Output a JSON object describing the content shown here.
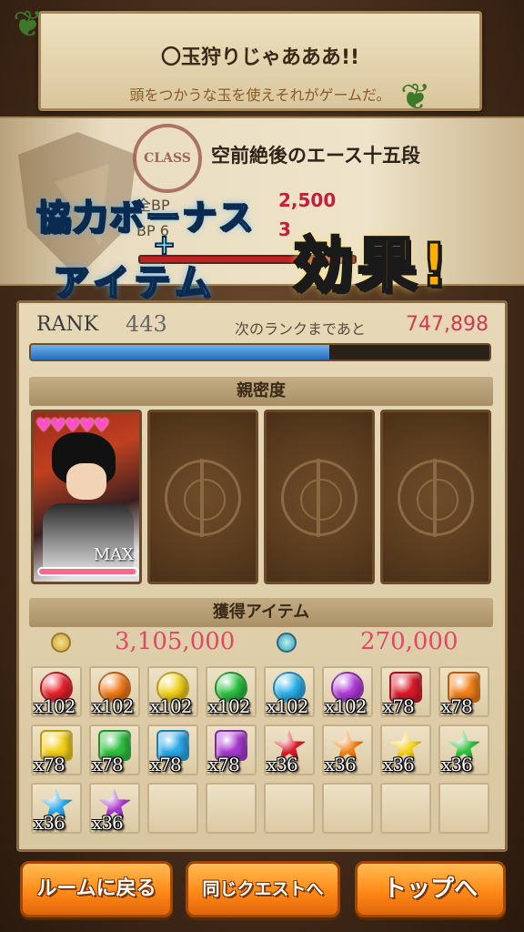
{
  "banner": {
    "title": "〇玉狩りじゃあああ!!",
    "subtitle": "頭をつかうな玉を使えそれがゲームだ。"
  },
  "class": {
    "stamp": "CLASS",
    "name": "空前絶後のエース十五段",
    "row1_label": "全BP",
    "row1_value": "2,500",
    "row2_label": "BP 6",
    "row2_value": "3"
  },
  "overlay": {
    "line1": "協力ボーナス",
    "plus": "+",
    "line2": "アイテム",
    "effect": "効果!"
  },
  "rank": {
    "label": "RANK",
    "value": "443",
    "next_label": "次のランクまであと",
    "next_value": "747,898",
    "progress": 0.65
  },
  "affinity": {
    "header": "親密度",
    "card_max": "MAX",
    "hearts": "♥♥♥♥♥",
    "affinity_level": 0.98
  },
  "items_header": "獲得アイテム",
  "rewards": {
    "coins": "3,105,000",
    "souls": "270,000"
  },
  "items": [
    {
      "color": "#e8202a",
      "shape": "round",
      "qty": "x102"
    },
    {
      "color": "#f07a18",
      "shape": "round",
      "qty": "x102"
    },
    {
      "color": "#f2d018",
      "shape": "round",
      "qty": "x102"
    },
    {
      "color": "#2ac040",
      "shape": "round",
      "qty": "x102"
    },
    {
      "color": "#28b0e8",
      "shape": "round",
      "qty": "x102"
    },
    {
      "color": "#b03ad8",
      "shape": "round",
      "qty": "x102"
    },
    {
      "color": "#d81a2a",
      "shape": "hex",
      "qty": "x78"
    },
    {
      "color": "#f08018",
      "shape": "hex",
      "qty": "x78"
    },
    {
      "color": "#f2d018",
      "shape": "hex",
      "qty": "x78"
    },
    {
      "color": "#30c040",
      "shape": "hex",
      "qty": "x78"
    },
    {
      "color": "#2aa8e8",
      "shape": "hex",
      "qty": "x78"
    },
    {
      "color": "#a83ad0",
      "shape": "hex",
      "qty": "x78"
    },
    {
      "color": "#d81a2a",
      "shape": "star",
      "qty": "x36"
    },
    {
      "color": "#f08018",
      "shape": "star",
      "qty": "x36"
    },
    {
      "color": "#f2d018",
      "shape": "star",
      "qty": "x36"
    },
    {
      "color": "#30c040",
      "shape": "star",
      "qty": "x36"
    },
    {
      "color": "#2aa8e8",
      "shape": "star",
      "qty": "x36"
    },
    {
      "color": "#a83ad0",
      "shape": "star",
      "qty": "x36"
    }
  ],
  "buttons": {
    "room": "ルームに戻る",
    "same_quest": "同じクエストへ",
    "top": "トップへ"
  }
}
